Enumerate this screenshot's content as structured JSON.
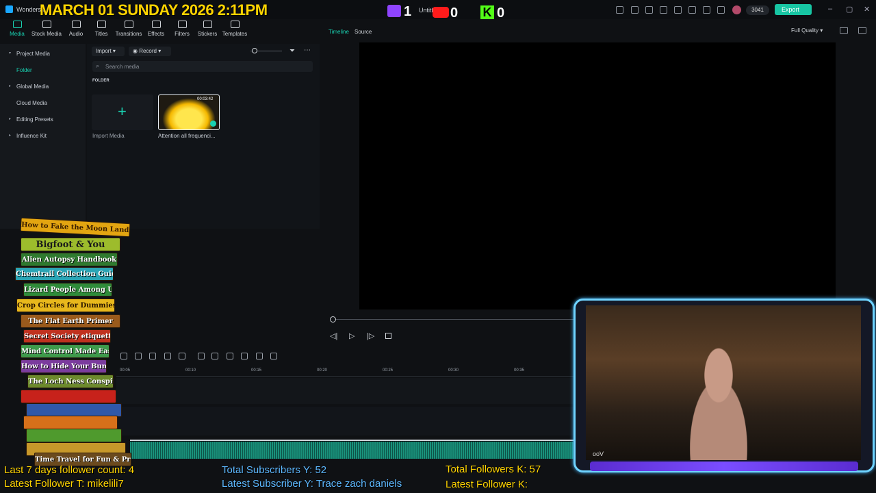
{
  "titlebar": {
    "app_name": "Wondersh",
    "project_title": "Untitl",
    "overlay_datetime": "MARCH 01 SUNDAY 2026 2:11PM",
    "twitch_count": "1",
    "youtube_count": "0",
    "kick_count": "0",
    "credits": "3041",
    "export_label": "Export",
    "window_controls": [
      "–",
      "▢",
      "✕"
    ]
  },
  "toolbar": {
    "items": [
      {
        "label": "Media",
        "icon": "media-icon"
      },
      {
        "label": "Stock Media",
        "icon": "stock-media-icon"
      },
      {
        "label": "Audio",
        "icon": "audio-icon"
      },
      {
        "label": "Titles",
        "icon": "titles-icon"
      },
      {
        "label": "Transitions",
        "icon": "transitions-icon"
      },
      {
        "label": "Effects",
        "icon": "effects-icon"
      },
      {
        "label": "Filters",
        "icon": "filters-icon"
      },
      {
        "label": "Stickers",
        "icon": "stickers-icon"
      },
      {
        "label": "Templates",
        "icon": "templates-icon"
      }
    ],
    "active": "Media"
  },
  "sidebar": {
    "items": [
      {
        "label": "Project Media",
        "arrow": "▾"
      },
      {
        "label": "Folder",
        "arrow": ""
      },
      {
        "label": "Global Media",
        "arrow": "▸"
      },
      {
        "label": "Cloud Media",
        "arrow": ""
      },
      {
        "label": "Editing Presets",
        "arrow": "▸"
      },
      {
        "label": "Influence Kit",
        "arrow": "▸"
      }
    ]
  },
  "media": {
    "import_label": "Import",
    "record_label": "Record",
    "search_placeholder": "Search media",
    "folder_header": "FOLDER",
    "import_tile_label": "Import Media",
    "clip": {
      "name": "Attention all frequenci...",
      "duration": "00:03:42"
    }
  },
  "preview": {
    "tabs": [
      "Timeline",
      "Source"
    ],
    "quality": "Full Quality"
  },
  "timeline": {
    "ticks": [
      "00:05",
      "00:10",
      "00:15",
      "00:20",
      "00:25",
      "00:30",
      "00:35"
    ]
  },
  "books": [
    "How to Fake the Moon Landing",
    "Bigfoot & You",
    "Alien Autopsy Handbook",
    "Chemtrail Collection Guide",
    "Lizard People Among Us",
    "Crop Circles for Dummies",
    "The Flat Earth Primer",
    "Secret Society etiquette",
    "Mind Control Made Easy",
    "How to Hide Your Bunker",
    "The Loch Ness Conspiracy",
    "Time Travel for Fun & Profit"
  ],
  "webcam": {
    "tag": "ooV"
  },
  "stats": {
    "follower_count_week": "Last 7 days follower count: 4",
    "latest_follower_t": "Latest Follower T: mikelili7",
    "total_subs_y": "Total Subscribers Y: 52",
    "latest_sub_y": "Latest Subscriber Y: Trace zach daniels",
    "total_followers_k": "Total Followers K: 57",
    "latest_follower_k": "Latest Follower K:"
  },
  "colors": {
    "accent": "#19d2b2",
    "overlay_yellow": "#ffd400",
    "overlay_blue": "#5db8ff"
  }
}
